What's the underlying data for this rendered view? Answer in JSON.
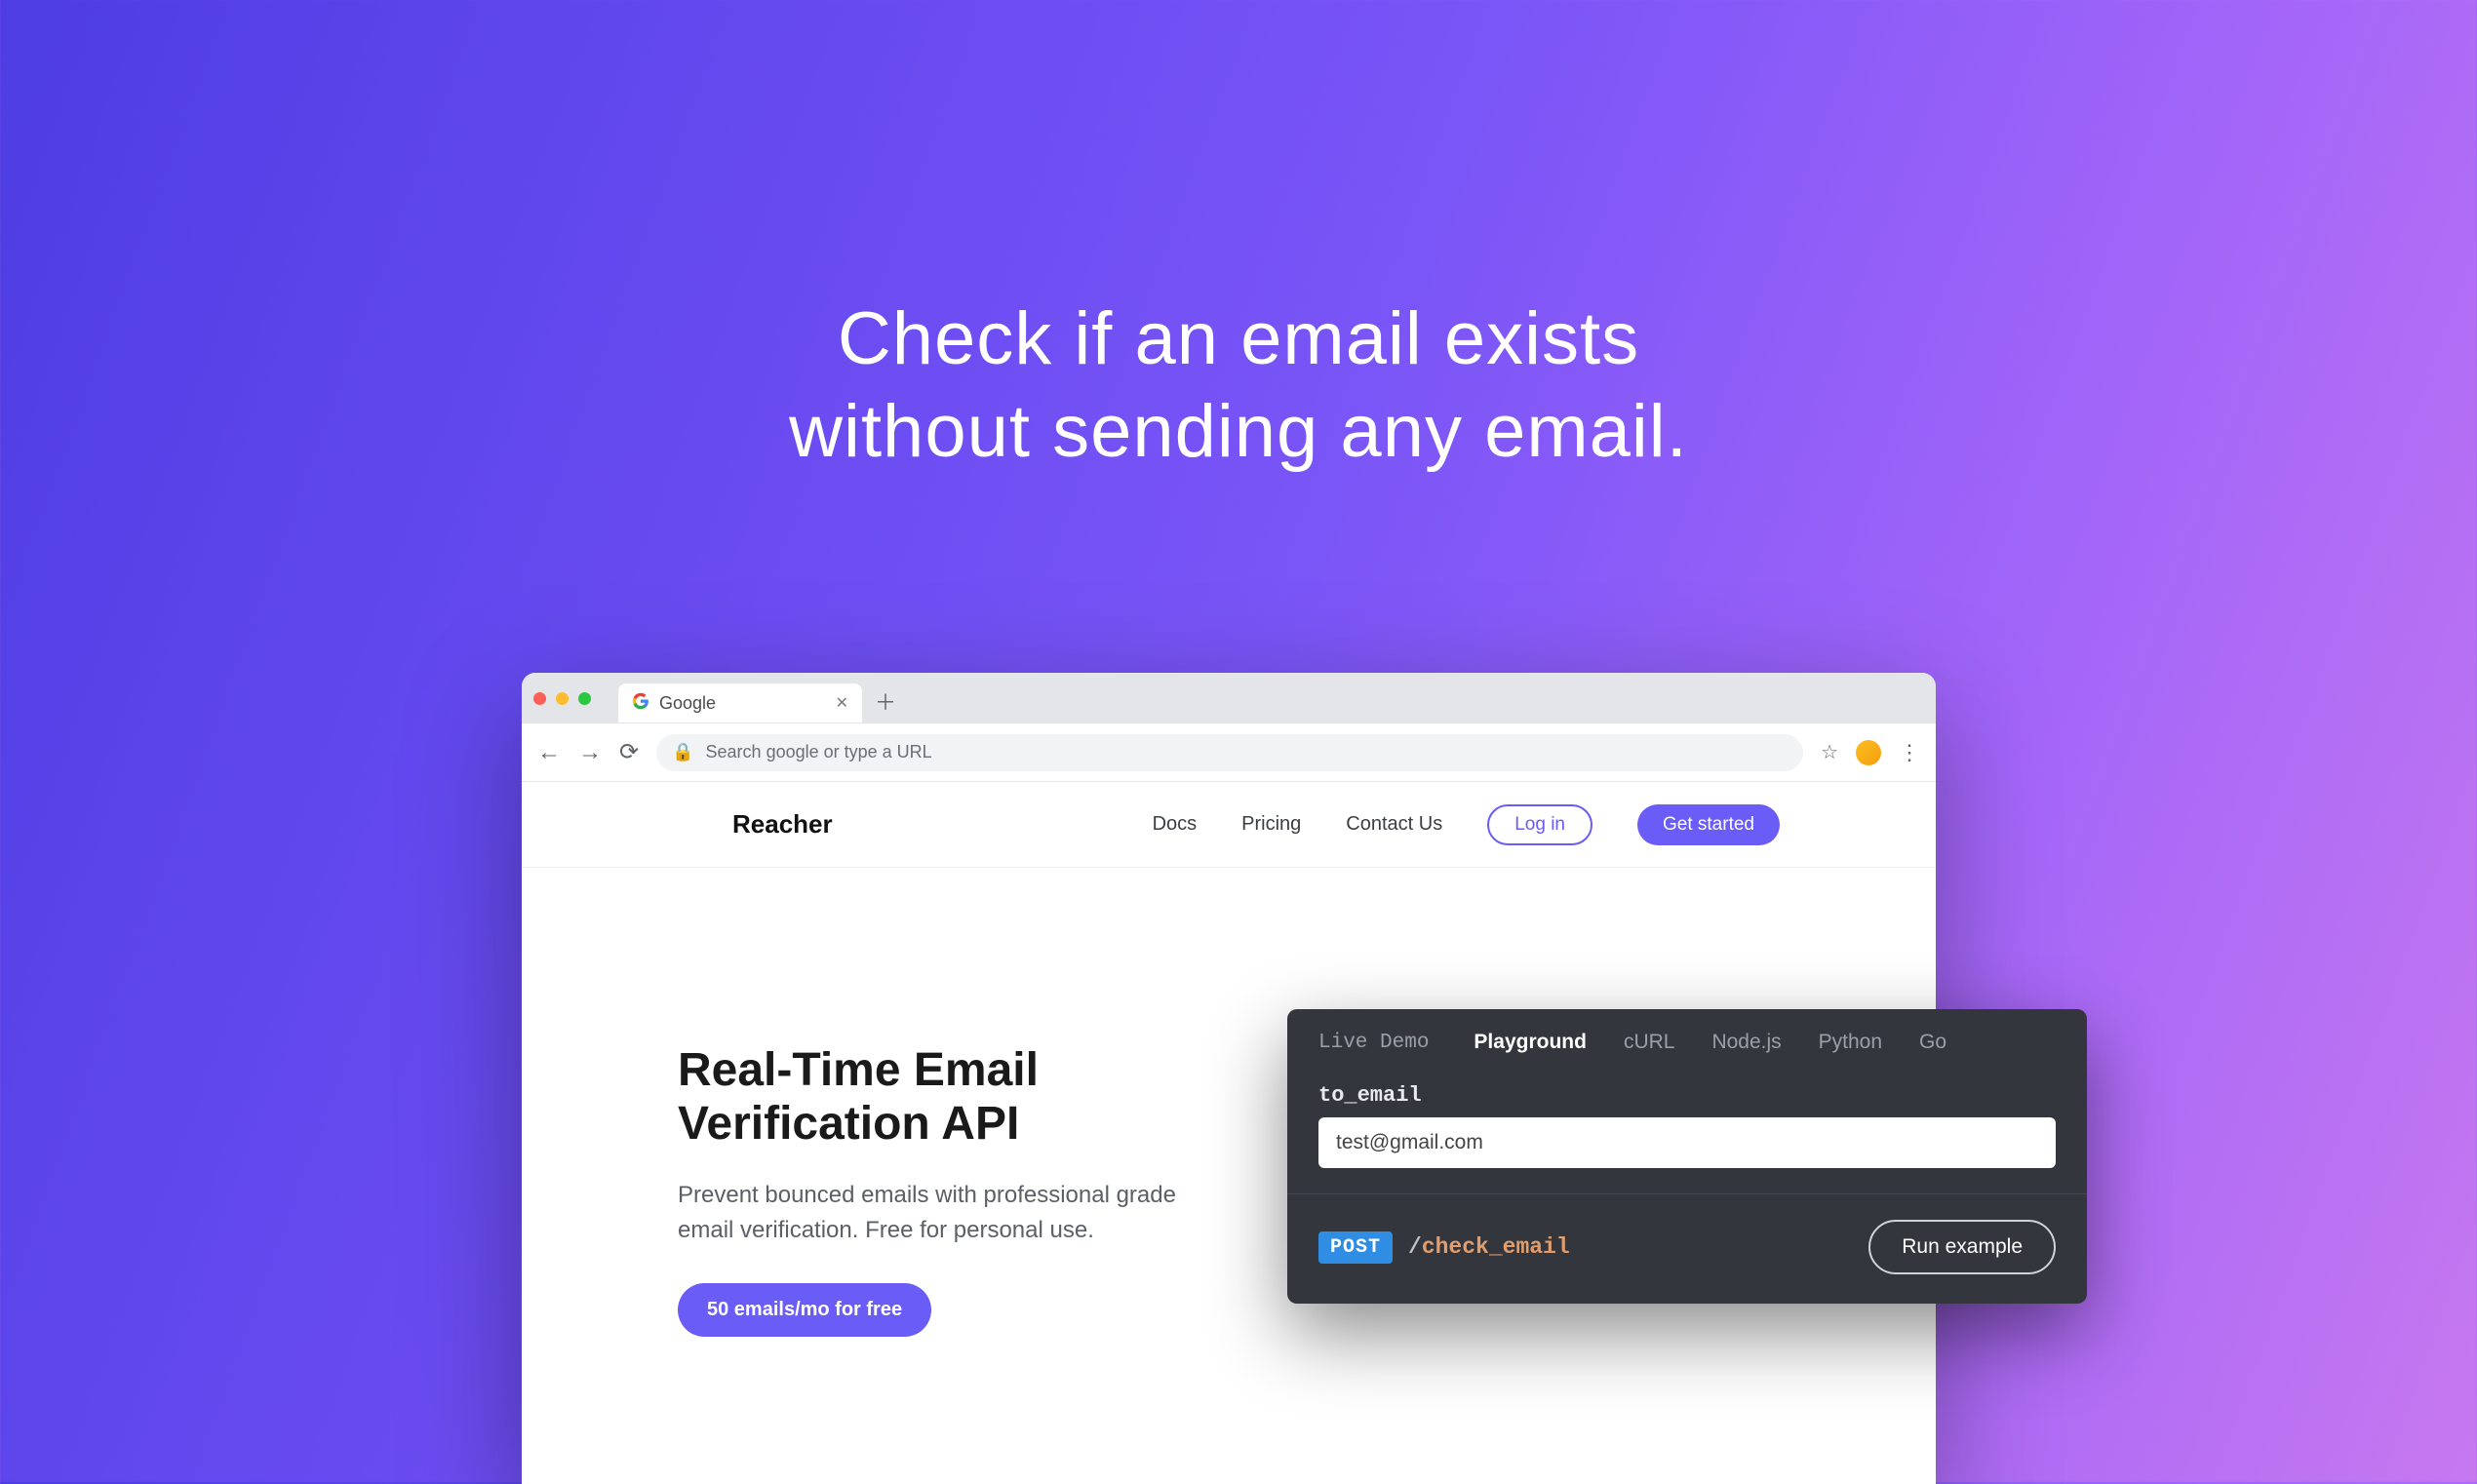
{
  "headline_line1": "Check if an email exists",
  "headline_line2": "without sending any email.",
  "browser": {
    "tab_title": "Google",
    "addr_placeholder": "Search google or type a URL"
  },
  "site": {
    "brand": "Reacher",
    "nav": {
      "docs": "Docs",
      "pricing": "Pricing",
      "contact": "Contact Us"
    },
    "login": "Log in",
    "get_started": "Get started",
    "hero_title_l1": "Real-Time Email",
    "hero_title_l2": "Verification API",
    "hero_sub": "Prevent bounced emails with professional grade email verification. Free for personal use.",
    "cta": "50 emails/mo for free"
  },
  "demo": {
    "title": "Live Demo",
    "tabs": {
      "playground": "Playground",
      "curl": "cURL",
      "node": "Node.js",
      "python": "Python",
      "go": "Go"
    },
    "field_label": "to_email",
    "field_value": "test@gmail.com",
    "method": "POST",
    "endpoint_slash": "/",
    "endpoint_path": "check_email",
    "run": "Run example"
  }
}
